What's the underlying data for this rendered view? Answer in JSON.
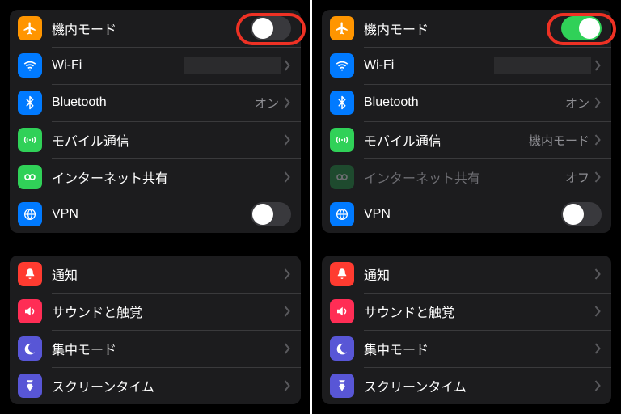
{
  "colors": {
    "airplane": "#ff9500",
    "wifi": "#007aff",
    "bluetooth": "#007aff",
    "cellular": "#30d158",
    "hotspot": "#30d158",
    "hotspot_dim": "#1e4a2e",
    "vpn": "#007aff",
    "notifications": "#ff3b30",
    "sounds": "#ff2d55",
    "focus": "#5856d6",
    "screentime": "#5856d6"
  },
  "labels": {
    "airplane": "機内モード",
    "wifi": "Wi-Fi",
    "bluetooth": "Bluetooth",
    "cellular": "モバイル通信",
    "hotspot": "インターネット共有",
    "vpn": "VPN",
    "notifications": "通知",
    "sounds": "サウンドと触覚",
    "focus": "集中モード",
    "screentime": "スクリーンタイム"
  },
  "values": {
    "bt_on": "オン",
    "cellular_airplane": "機内モード",
    "hotspot_off": "オフ"
  },
  "left": {
    "airplane_on": false,
    "vpn_on": false
  },
  "right": {
    "airplane_on": true,
    "vpn_on": false,
    "hotspot_dimmed": true
  }
}
